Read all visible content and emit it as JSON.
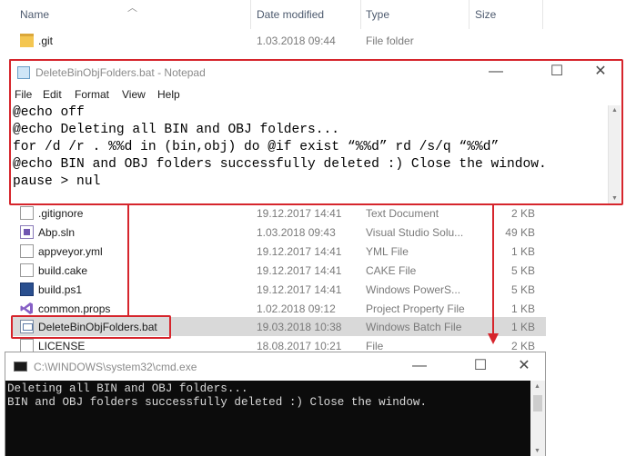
{
  "explorer": {
    "columns": {
      "name": "Name",
      "date": "Date modified",
      "type": "Type",
      "size": "Size"
    },
    "files": [
      {
        "name": ".git",
        "date": "1.03.2018 09:44",
        "type": "File folder",
        "size": "",
        "icon": "folder-icon"
      },
      {
        "name": ".gitignore",
        "date": "19.12.2017 14:41",
        "type": "Text Document",
        "size": "2 KB",
        "icon": "text-file-icon"
      },
      {
        "name": "Abp.sln",
        "date": "1.03.2018 09:43",
        "type": "Visual Studio Solu...",
        "size": "49 KB",
        "icon": "solution-file-icon"
      },
      {
        "name": "appveyor.yml",
        "date": "19.12.2017 14:41",
        "type": "YML File",
        "size": "1 KB",
        "icon": "file-icon"
      },
      {
        "name": "build.cake",
        "date": "19.12.2017 14:41",
        "type": "CAKE File",
        "size": "5 KB",
        "icon": "file-icon"
      },
      {
        "name": "build.ps1",
        "date": "19.12.2017 14:41",
        "type": "Windows PowerS...",
        "size": "5 KB",
        "icon": "powershell-file-icon"
      },
      {
        "name": "common.props",
        "date": "1.02.2018 09:12",
        "type": "Project Property File",
        "size": "1 KB",
        "icon": "visual-studio-file-icon"
      },
      {
        "name": "DeleteBinObjFolders.bat",
        "date": "19.03.2018 10:38",
        "type": "Windows Batch File",
        "size": "1 KB",
        "icon": "batch-file-icon"
      },
      {
        "name": "LICENSE",
        "date": "18.08.2017 10:21",
        "type": "File",
        "size": "2 KB",
        "icon": "file-icon"
      }
    ]
  },
  "notepad": {
    "title": "DeleteBinObjFolders.bat - Notepad",
    "menu": [
      "File",
      "Edit",
      "Format",
      "View",
      "Help"
    ],
    "lines": [
      "@echo off",
      "@echo Deleting all BIN and OBJ folders...",
      "for /d /r . %%d in (bin,obj) do @if exist “%%d” rd /s/q “%%d”",
      "@echo BIN and OBJ folders successfully deleted :) Close the window.",
      "pause > nul"
    ]
  },
  "cmd": {
    "title": "C:\\WINDOWS\\system32\\cmd.exe",
    "lines": [
      "Deleting all BIN and OBJ folders...",
      "BIN and OBJ folders successfully deleted :) Close the window."
    ]
  },
  "window_buttons": {
    "minimize": "—",
    "maximize": "☐",
    "close": "✕"
  },
  "colors": {
    "annotation_red": "#d6252c",
    "selected_row": "#d9d9d9",
    "console_bg": "#0c0c0c",
    "console_text": "#d9d9d9",
    "folder_yellow": "#f4c651"
  }
}
